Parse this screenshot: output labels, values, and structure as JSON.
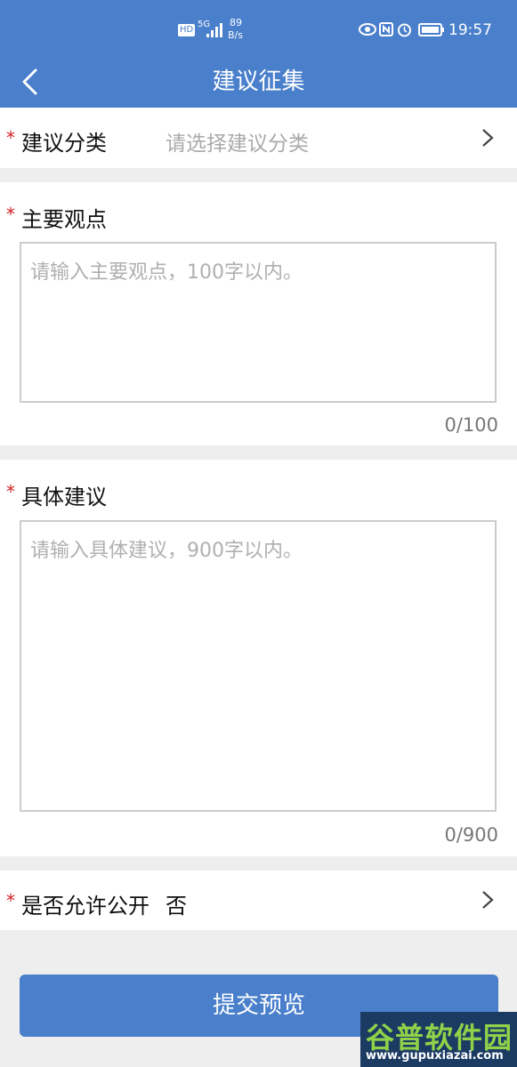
{
  "status_bar": {
    "hd": "HD",
    "network": "5G",
    "speed_value": "89",
    "speed_unit": "B/s",
    "time": "19:57"
  },
  "header": {
    "title": "建议征集"
  },
  "category": {
    "label": "建议分类",
    "placeholder": "请选择建议分类"
  },
  "main_point": {
    "label": "主要观点",
    "placeholder": "请输入主要观点，100字以内。",
    "counter": "0/100"
  },
  "suggestion": {
    "label": "具体建议",
    "placeholder": "请输入具体建议，900字以内。",
    "counter": "0/900"
  },
  "public": {
    "label": "是否允许公开",
    "value": "否"
  },
  "required_mark": "*",
  "submit_label": "提交预览",
  "watermark": {
    "title": "谷普软件园",
    "url": "www.gupuxiazai.com"
  }
}
